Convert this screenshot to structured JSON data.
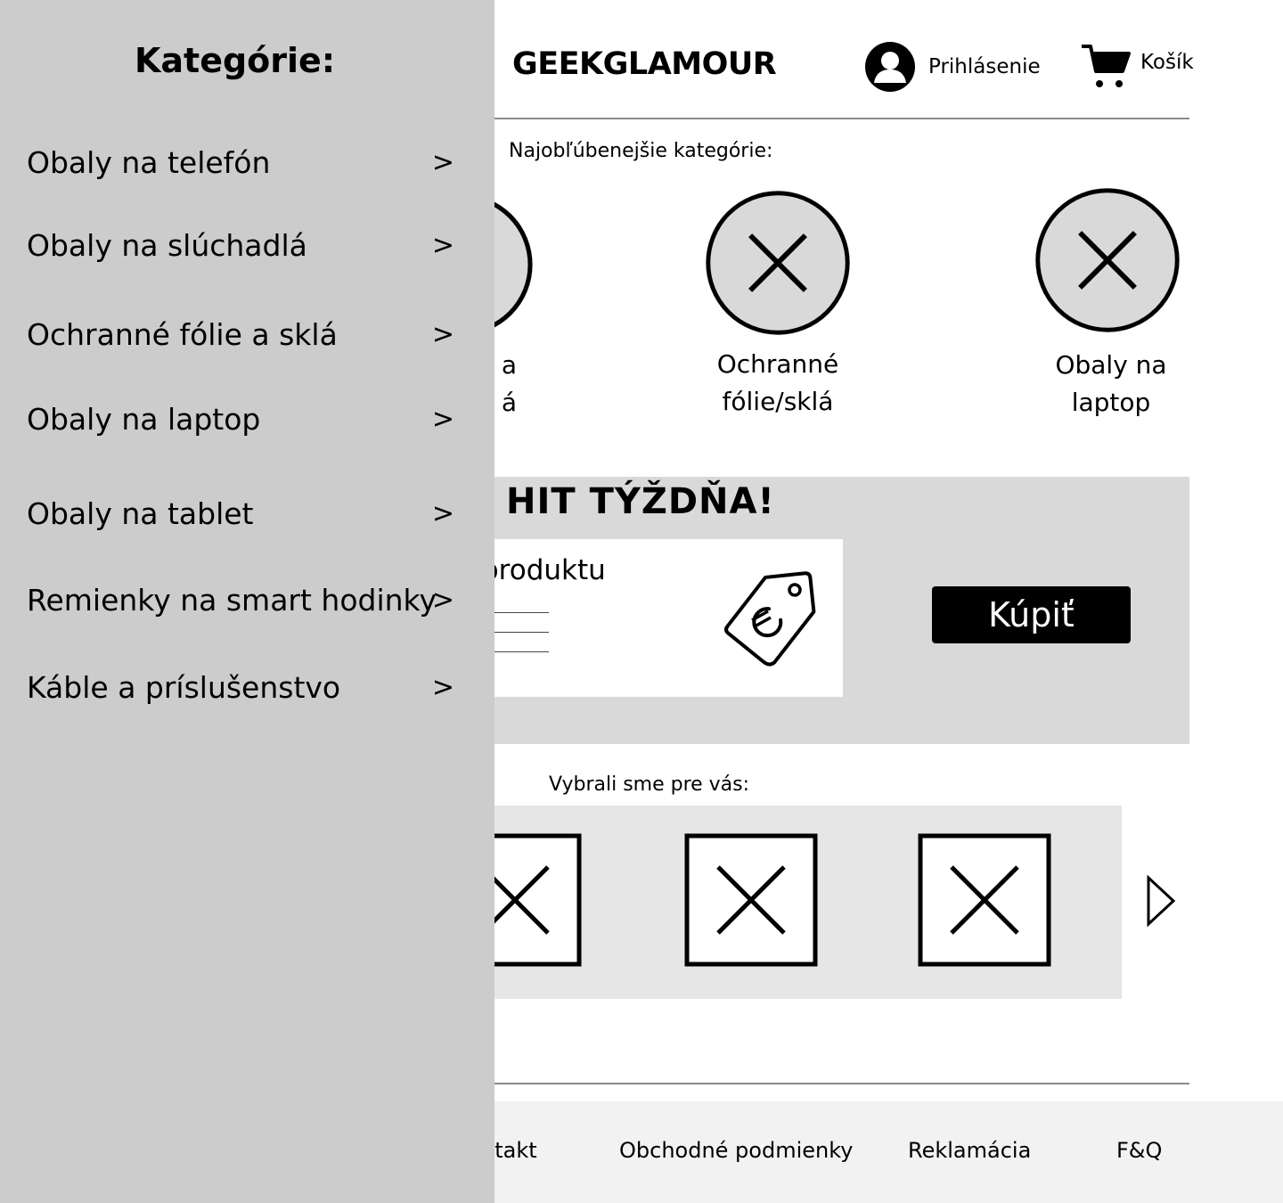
{
  "header": {
    "brand": "GEEKGLAMOUR",
    "login_label": "Prihlásenie",
    "cart_label": "Košík"
  },
  "favorites": {
    "title": "Najobľúbenejšie kategórie:",
    "items": [
      {
        "label": "a\ná"
      },
      {
        "label": "Ochranné\nfólie/sklá"
      },
      {
        "label": "Obaly na\nlaptop"
      }
    ]
  },
  "hit": {
    "title": "HIT TÝŽDŇA!",
    "product_text": "produktu",
    "buy_label": "Kúpiť",
    "tag_icon": "price-tag-euro-icon"
  },
  "picked": {
    "title": "Vybrali sme pre vás:",
    "next_icon": "chevron-right-icon"
  },
  "footer": {
    "links": [
      "ntakt",
      "Obchodné podmienky",
      "Reklamácia",
      "F&Q"
    ]
  },
  "drawer": {
    "title": "Kategórie:",
    "chevron": ">",
    "items": [
      {
        "label": "Obaly na telefón"
      },
      {
        "label": "Obaly na slúchadlá"
      },
      {
        "label": "Ochranné fólie a sklá"
      },
      {
        "label": "Obaly na laptop"
      },
      {
        "label": "Obaly na tablet"
      },
      {
        "label": "Remienky na smart hodinky"
      },
      {
        "label": "Káble a príslušenstvo"
      }
    ]
  },
  "colors": {
    "drawer_bg": "#cccccc",
    "hit_bg": "#d9d9d9",
    "carousel_bg": "#e6e6e6",
    "footer_bg": "#f2f2f2",
    "buy_button_bg": "#000000"
  }
}
